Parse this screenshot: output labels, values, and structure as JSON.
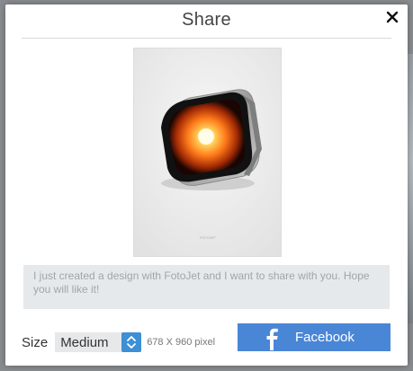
{
  "dialog": {
    "title": "Share",
    "close_icon": "close-icon"
  },
  "preview": {
    "image": "design-thumbnail",
    "caption": "FOTOJET"
  },
  "message": {
    "text": "I just created a design with FotoJet and I want to share with you. Hope you will like it!"
  },
  "size": {
    "label": "Size",
    "selected": "Medium",
    "dimensions": "678 X 960 pixel"
  },
  "share_button": {
    "label": "Facebook",
    "icon": "facebook-icon",
    "color": "#4a86d6"
  }
}
